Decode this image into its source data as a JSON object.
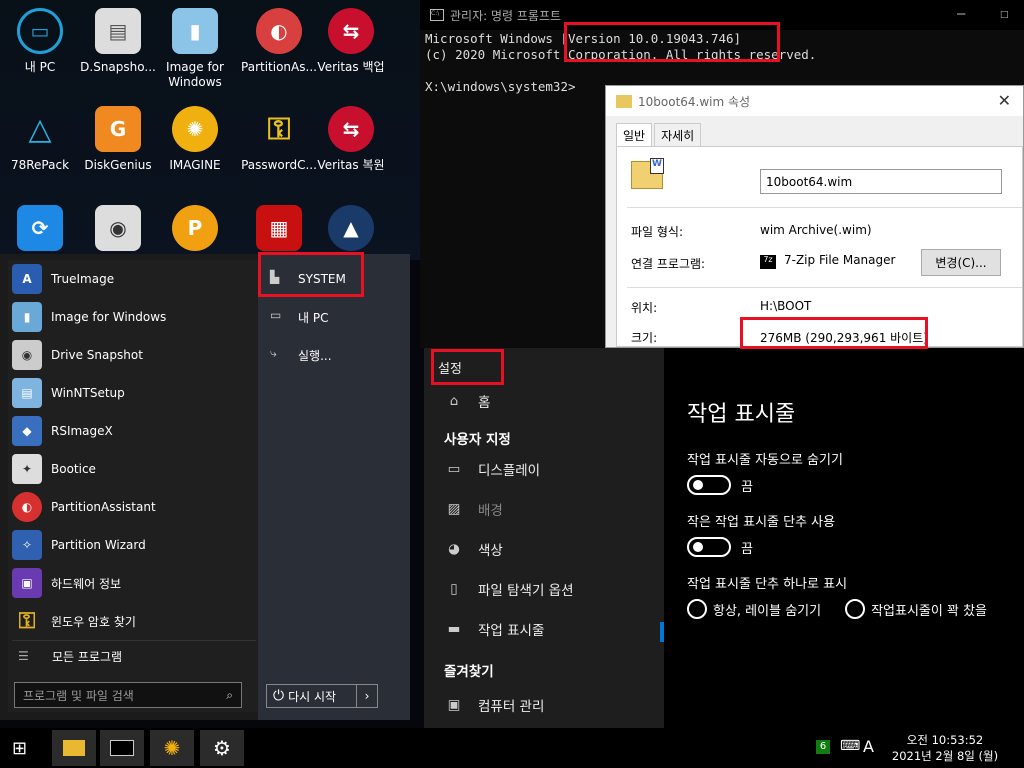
{
  "desktop": {
    "icons": [
      {
        "label": "내 PC"
      },
      {
        "label": "D.Snapsho..."
      },
      {
        "label": "Image for\nWindows"
      },
      {
        "label": "PartitionAs..."
      },
      {
        "label": "Veritas 백업"
      },
      {
        "label": "78RePack"
      },
      {
        "label": "DiskGenius"
      },
      {
        "label": "IMAGINE"
      },
      {
        "label": "PasswordC..."
      },
      {
        "label": "Veritas 복원"
      }
    ]
  },
  "cmd": {
    "title": "관리자: 명령 프롬프트",
    "line1": "Microsoft Windows [Version 10.0.19043.746]",
    "line2": "(c) 2020 Microsoft Corporation. All rights reserved.",
    "prompt": "X:\\windows\\system32>"
  },
  "props": {
    "title": "10boot64.wim 속성",
    "tab_general": "일반",
    "tab_details": "자세히",
    "filename": "10boot64.wim",
    "type_label": "파일 형식:",
    "type_value": "wim Archive(.wim)",
    "program_label": "연결 프로그램:",
    "program_value": "7-Zip File Manager",
    "change_btn": "변경(C)...",
    "location_label": "위치:",
    "location_value": "H:\\BOOT",
    "size_label": "크기:",
    "size_value": "276MB (290,293,961 바이트)"
  },
  "start": {
    "items": [
      {
        "label": "TrueImage",
        "color": "#2a5db0",
        "glyph": "A"
      },
      {
        "label": "Image for Windows",
        "color": "#6aa8d8",
        "glyph": "▮"
      },
      {
        "label": "Drive Snapshot",
        "color": "#cccccc",
        "glyph": "◉"
      },
      {
        "label": "WinNTSetup",
        "color": "#7fb3e0",
        "glyph": "▤"
      },
      {
        "label": "RSImageX",
        "color": "#3a6fc0",
        "glyph": "◆"
      },
      {
        "label": "Bootice",
        "color": "#dddddd",
        "glyph": "✦"
      },
      {
        "label": "PartitionAssistant",
        "color": "#d63030",
        "glyph": "◐"
      },
      {
        "label": "Partition Wizard",
        "color": "#3060b0",
        "glyph": "✧"
      },
      {
        "label": "하드웨어 정보",
        "color": "#6a3ab0",
        "glyph": "▣"
      },
      {
        "label": "윈도우 암호 찾기",
        "color": "#e0b020",
        "glyph": "⚿"
      }
    ],
    "all_programs": "모든 프로그램",
    "search_placeholder": "프로그램 및 파일 검색",
    "right": {
      "system": "SYSTEM",
      "mypc": "내 PC",
      "run": "실행..."
    },
    "restart": "다시 시작"
  },
  "settings": {
    "title": "설정",
    "home": "홈",
    "section_custom": "사용자 지정",
    "nav": [
      "디스플레이",
      "배경",
      "색상",
      "파일 탐색기 옵션",
      "작업 표시줄"
    ],
    "section_fav": "즐겨찾기",
    "computer_mgmt": "컴퓨터 관리",
    "page_title": "작업 표시줄",
    "opt1": "작업 표시줄 자동으로 숨기기",
    "opt1_state": "끔",
    "opt2": "작은 작업 표시줄 단추 사용",
    "opt2_state": "끔",
    "opt3": "작업 표시줄 단추 하나로 표시",
    "radio1": "항상, 레이블 숨기기",
    "radio2": "작업표시줄이 꽉 찼을"
  },
  "taskbar": {
    "badge": "6",
    "ime": "A",
    "time": "오전 10:53:52",
    "date": "2021년 2월 8일 (월)"
  },
  "colors": {
    "highlight": "#e81123",
    "accent": "#0078d7"
  }
}
